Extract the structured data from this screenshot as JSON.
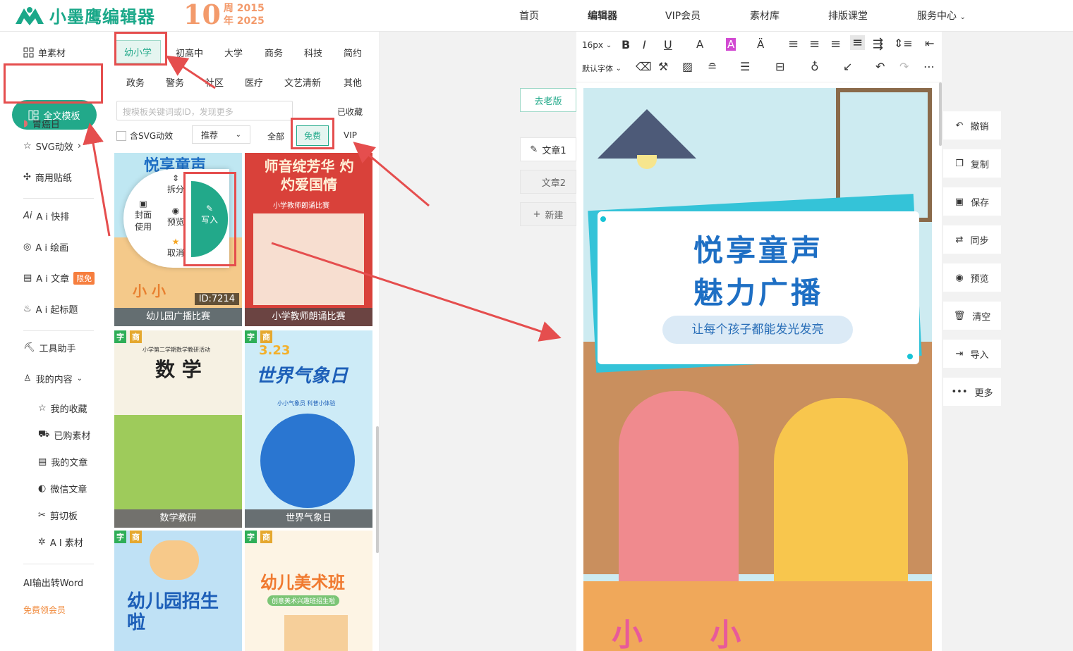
{
  "brand": {
    "logo_text": "小墨鹰编辑器",
    "anniv_number": "10",
    "anniv_line1": "周 2015",
    "anniv_line2": "年 2025"
  },
  "topnav": [
    {
      "label": "首页"
    },
    {
      "label": "编辑器"
    },
    {
      "label": "VIP会员"
    },
    {
      "label": "素材库"
    },
    {
      "label": "排版课堂"
    },
    {
      "label": "服务中心"
    }
  ],
  "left_nav": {
    "single_material": "单素材",
    "full_template": "全文模板",
    "cancer_day": "胃癌日",
    "svg": "SVG动效",
    "sticker": "商用贴纸",
    "ai_layout": "A i 快排",
    "ai_paint": "A i 绘画",
    "ai_article": "A i 文章",
    "limited_free": "限免",
    "ai_title": "A i 起标题",
    "tools": "工具助手",
    "my_content": "我的内容",
    "favorites": "我的收藏",
    "purchased": "已购素材",
    "my_articles": "我的文章",
    "wechat_articles": "微信文章",
    "clipboard": "剪切板",
    "ai_material": "A I 素材",
    "ai_word": "AI输出转Word",
    "free_member": "免费领会员"
  },
  "categories": [
    {
      "label": "幼小学"
    },
    {
      "label": "初高中"
    },
    {
      "label": "大学"
    },
    {
      "label": "商务"
    },
    {
      "label": "科技"
    },
    {
      "label": "简约"
    },
    {
      "label": "政务"
    },
    {
      "label": "警务"
    },
    {
      "label": "社区"
    },
    {
      "label": "医疗"
    },
    {
      "label": "文艺清新"
    },
    {
      "label": "其他"
    }
  ],
  "search": {
    "placeholder": "搜模板关键词或ID，发现更多",
    "favorited": "已收藏"
  },
  "filters": {
    "svg": "含SVG动效",
    "sort": "推荐",
    "all": "全部",
    "free": "免费",
    "vip": "VIP"
  },
  "radial_menu": {
    "split": "拆分",
    "cover": "封面",
    "use": "使用",
    "preview": "预览",
    "cancel": "取消",
    "write": "写入"
  },
  "templates": [
    {
      "caption": "幼儿园广播比赛",
      "title": "悦享童声",
      "id_label": "ID:7214",
      "badge_char": "",
      "badge_biz": "",
      "chars": "小 小"
    },
    {
      "caption": "小学教师朗诵比赛",
      "title": "师音绽芳华 灼灼爱国情",
      "subtitle": "小学教师朗诵比赛",
      "badge_char": "",
      "badge_biz": ""
    },
    {
      "caption": "数学教研",
      "title": "数 学",
      "subtitle": "小学第二学期数学教研活动",
      "badge_char": "字",
      "badge_biz": "商"
    },
    {
      "caption": "世界气象日",
      "title": "世界气象日",
      "subtitle": "小小气象员 科普小体验",
      "date": "3.23",
      "badge_char": "字",
      "badge_biz": "商"
    },
    {
      "caption": "",
      "title": "幼儿园招生啦",
      "badge_char": "字",
      "badge_biz": "商"
    },
    {
      "caption": "",
      "title": "幼儿美术班",
      "subtitle": "创意美术兴趣班招生啦",
      "badge_char": "字",
      "badge_biz": "商"
    }
  ],
  "editor": {
    "font_size": "16px",
    "default_font": "默认字体",
    "old_version": "去老版",
    "article1": "文章1",
    "article2": "文章2",
    "new": "新建"
  },
  "canvas_content": {
    "title_line1": "悦享童声",
    "title_line2": "魅力广播",
    "subtitle": "让每个孩子都能发光发亮",
    "chars": "小 小"
  },
  "right_tools": [
    {
      "label": "撤销"
    },
    {
      "label": "复制"
    },
    {
      "label": "保存"
    },
    {
      "label": "同步"
    },
    {
      "label": "预览"
    },
    {
      "label": "清空"
    },
    {
      "label": "导入"
    },
    {
      "label": "更多"
    }
  ],
  "colors": {
    "brand": "#22a98a",
    "highlight": "#e54e4e",
    "title_blue": "#1e6fc4"
  }
}
